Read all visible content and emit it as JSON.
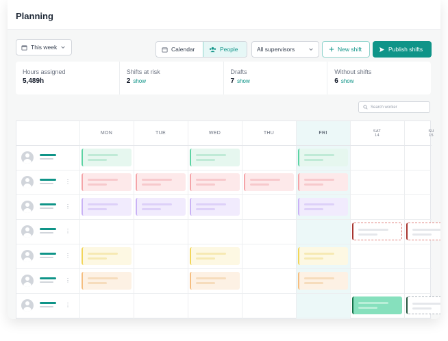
{
  "app": {
    "title": "Planning"
  },
  "toolbar": {
    "period_label": "This week",
    "view_calendar_label": "Calendar",
    "view_people_label": "People",
    "supervisors_label": "All supervisors",
    "new_shift_label": "New shift",
    "publish_label": "Publish shifts",
    "accent_color": "#0f9488"
  },
  "stats": [
    {
      "label": "Hours assigned",
      "value": "5,489h",
      "link": ""
    },
    {
      "label": "Shifts at risk",
      "value": "2",
      "link": "show"
    },
    {
      "label": "Drafts",
      "value": "7",
      "link": "show"
    },
    {
      "label": "Without shifts",
      "value": "6",
      "link": "show"
    }
  ],
  "search": {
    "placeholder": "Search worker"
  },
  "days": [
    {
      "label": "MON",
      "sub": ""
    },
    {
      "label": "TUE",
      "sub": ""
    },
    {
      "label": "WED",
      "sub": ""
    },
    {
      "label": "THU",
      "sub": ""
    },
    {
      "label": "FRI",
      "sub": ""
    },
    {
      "label": "SAT",
      "sub": "14"
    },
    {
      "label": "SU",
      "sub": "15"
    }
  ],
  "rows": [
    {
      "menu": false,
      "shifts": [
        {
          "day": 0,
          "color": "green"
        },
        {
          "day": 2,
          "color": "green"
        },
        {
          "day": 4,
          "color": "green"
        }
      ]
    },
    {
      "menu": true,
      "shifts": [
        {
          "day": 0,
          "color": "red"
        },
        {
          "day": 1,
          "color": "red"
        },
        {
          "day": 2,
          "color": "red"
        },
        {
          "day": 3,
          "color": "red"
        },
        {
          "day": 4,
          "color": "red"
        }
      ]
    },
    {
      "menu": true,
      "shifts": [
        {
          "day": 0,
          "color": "purple"
        },
        {
          "day": 1,
          "color": "purple"
        },
        {
          "day": 2,
          "color": "purple"
        },
        {
          "day": 4,
          "color": "purple"
        }
      ]
    },
    {
      "menu": true,
      "shifts": [
        {
          "day": 5,
          "color": "draft-red"
        },
        {
          "day": 6,
          "color": "draft-red"
        }
      ]
    },
    {
      "menu": true,
      "shifts": [
        {
          "day": 0,
          "color": "yellow"
        },
        {
          "day": 2,
          "color": "yellow"
        },
        {
          "day": 4,
          "color": "yellow"
        }
      ]
    },
    {
      "menu": true,
      "shifts": [
        {
          "day": 0,
          "color": "orange"
        },
        {
          "day": 2,
          "color": "orange"
        },
        {
          "day": 4,
          "color": "orange"
        }
      ]
    },
    {
      "menu": true,
      "shifts": [
        {
          "day": 5,
          "color": "solid-green"
        },
        {
          "day": 6,
          "color": "draft-green"
        }
      ]
    }
  ]
}
